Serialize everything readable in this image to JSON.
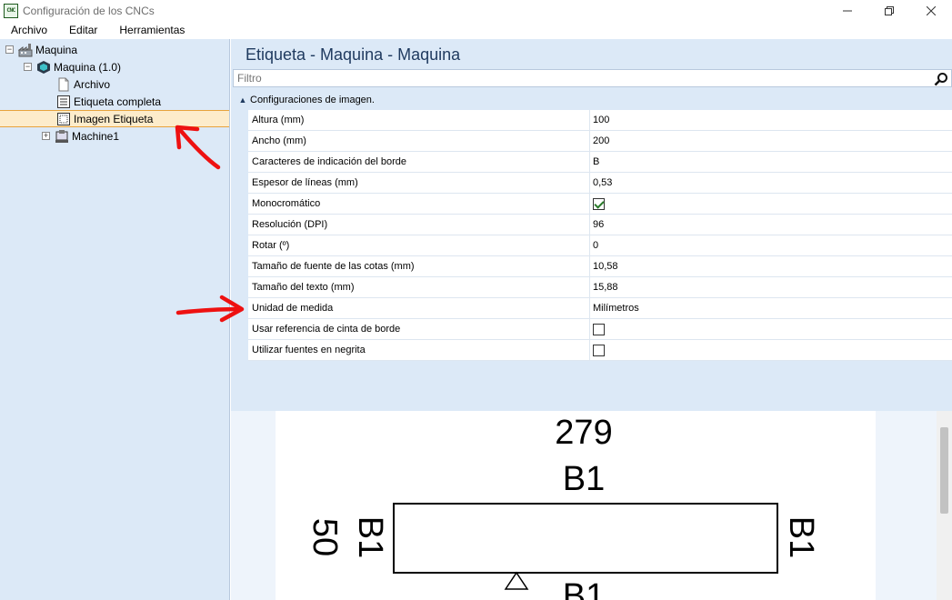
{
  "window": {
    "title": "Configuración de los CNCs",
    "icon_text": "CNC"
  },
  "menu": [
    "Archivo",
    "Editar",
    "Herramientas"
  ],
  "tree": {
    "root": "Maquina",
    "machine": "Maquina (1.0)",
    "children": [
      "Archivo",
      "Etiqueta completa",
      "Imagen Etiqueta"
    ],
    "machine1": "Machine1"
  },
  "panel": {
    "title": "Etiqueta - Maquina - Maquina",
    "filter_placeholder": "Filtro",
    "category": "Configuraciones de imagen."
  },
  "properties": [
    {
      "name": "Altura (mm)",
      "value": "100",
      "type": "text"
    },
    {
      "name": "Ancho (mm)",
      "value": "200",
      "type": "text"
    },
    {
      "name": "Caracteres de indicación del borde",
      "value": "B",
      "type": "text"
    },
    {
      "name": "Espesor de líneas (mm)",
      "value": "0,53",
      "type": "text"
    },
    {
      "name": "Monocromático",
      "value": true,
      "type": "bool"
    },
    {
      "name": "Resolución (DPI)",
      "value": "96",
      "type": "text"
    },
    {
      "name": "Rotar (º)",
      "value": "0",
      "type": "text"
    },
    {
      "name": "Tamaño de fuente de las cotas (mm)",
      "value": "10,58",
      "type": "text"
    },
    {
      "name": "Tamaño del texto (mm)",
      "value": "15,88",
      "type": "text"
    },
    {
      "name": "Unidad de medida",
      "value": "Milímetros",
      "type": "text"
    },
    {
      "name": "Usar referencia de cinta de borde",
      "value": false,
      "type": "bool"
    },
    {
      "name": "Utilizar fuentes en negrita",
      "value": false,
      "type": "bool"
    }
  ],
  "preview": {
    "dimension_top": "279",
    "edge_top": "B1",
    "edge_left": "B1",
    "dimension_left": "50",
    "edge_right": "B1",
    "edge_bottom": "B1"
  },
  "colors": {
    "annotation_arrow": "#ee1111",
    "selection": "#fdeccb",
    "panel_bg": "#dce9f7"
  }
}
